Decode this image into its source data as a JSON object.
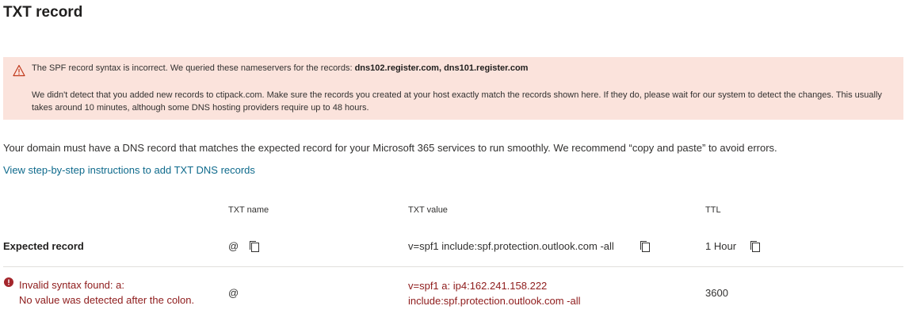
{
  "page": {
    "title": "TXT record"
  },
  "warning": {
    "line1_prefix": "The SPF record syntax is incorrect. We queried these nameservers for the records: ",
    "line1_servers": "dns102.register.com, dns101.register.com",
    "line2": "We didn't detect that you added new records to ctipack.com. Make sure the records you created at your host exactly match the records shown here. If they do, please wait for our system to detect the changes. This usually takes around 10 minutes, although some DNS hosting providers require up to 48 hours."
  },
  "intro_text": "Your domain must have a DNS record that matches the expected record for your Microsoft 365 services to run smoothly. We recommend “copy and paste” to avoid errors.",
  "instructions_link": "View step-by-step instructions to add TXT DNS records",
  "table": {
    "headers": {
      "name": "TXT name",
      "value": "TXT value",
      "ttl": "TTL"
    },
    "expected": {
      "label": "Expected record",
      "name": "@",
      "value": "v=spf1 include:spf.protection.outlook.com -all",
      "ttl": "1 Hour"
    },
    "found": {
      "error_line1": "Invalid syntax found: a:",
      "error_line2": "No value was detected after the colon.",
      "name": "@",
      "value_line1": "v=spf1 a: ip4:162.241.158.222",
      "value_line2": "include:spf.protection.outlook.com -all",
      "ttl": "3600"
    }
  },
  "colors": {
    "warning_bg": "#fbe3dc",
    "link": "#0e6a8c",
    "error": "#8e1b1b",
    "warning_icon": "#d83b01"
  },
  "icons": {
    "warning": "warning-triangle-icon",
    "copy": "copy-icon",
    "error": "error-circle-icon"
  }
}
